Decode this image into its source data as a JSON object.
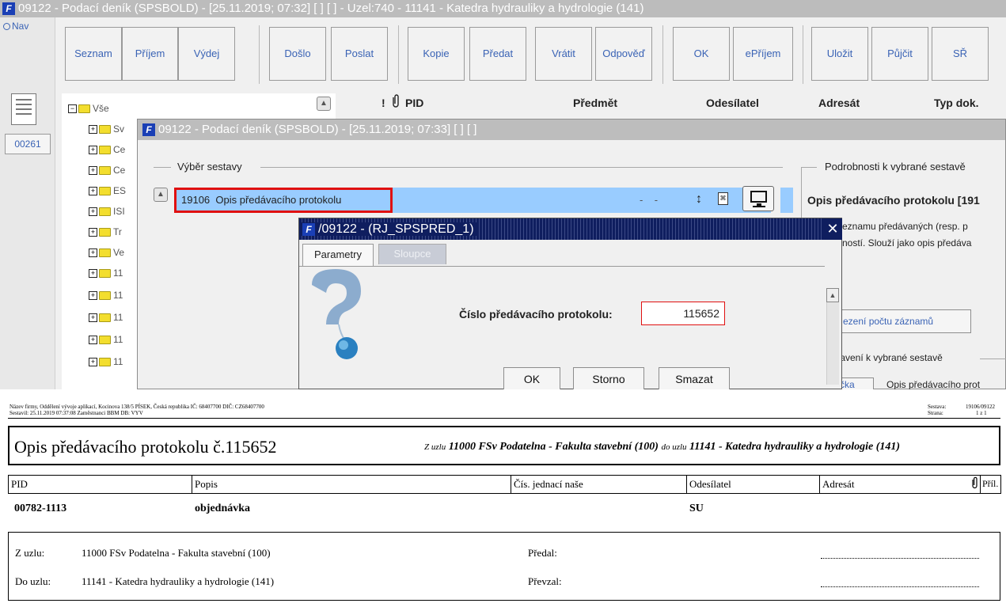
{
  "window": {
    "title": "09122 - Podací deník (SPSBOLD) - [25.11.2019; 07:32]  [ ]  [ ] - Uzel:740 - 11141 - Katedra hydrauliky a hydrologie (141)",
    "logo": "F"
  },
  "nav": {
    "label": "Nav",
    "badge": "00261"
  },
  "toolbar": {
    "buttons": [
      "Seznam",
      "Příjem",
      "Výdej",
      "Došlo",
      "Poslat",
      "Kopie",
      "Předat",
      "Vrátit",
      "Odpověď",
      "OK",
      "ePříjem",
      "Uložit",
      "Půjčit",
      "SŘ"
    ]
  },
  "tree": {
    "root": "Vše",
    "items": [
      "Sv",
      "Ce",
      "Ce",
      "ES",
      "ISI",
      "Tr",
      "Ve",
      "11",
      "11",
      "11",
      "11",
      "11"
    ]
  },
  "columns": {
    "mark": "!",
    "pid": "PID",
    "subject": "Předmět",
    "sender": "Odesílatel",
    "recipient": "Adresát",
    "type": "Typ dok."
  },
  "dialog1": {
    "title": "09122 - Podací deník (SPSBOLD) - [25.11.2019; 07:33]  [ ]  [ ]",
    "group_left": "Výběr sestavy",
    "group_right": "Podrobnosti k vybrané sestavě",
    "selected_report": {
      "code": "19106",
      "name": "Opis předávacího protokolu"
    },
    "dashes": "-    -",
    "detail_title": "Opis předávacího protokolu [191",
    "detail_text_1": "eznamu předávaných (resp. p",
    "detail_text_2": "ností. Slouží jako opis předáva",
    "limit_button": "ezení počtu záznamů",
    "settings_group": "stavení k vybrané sestavě",
    "bottom_left": "čka",
    "bottom_right": "Opis předávacího prot"
  },
  "dialog2": {
    "title": "/09122 - (RJ_SPSPRED_1)",
    "tabs": [
      "Parametry",
      "Sloupce"
    ],
    "field_label": "Číslo předávacího protokolu:",
    "field_value": "115652",
    "buttons": {
      "ok": "OK",
      "cancel": "Storno",
      "clear": "Smazat"
    }
  },
  "report": {
    "company_line": "Název firmy, Oddělení vývoje aplikací, Kocinova 138/5 PÍSEK, Česká republika  IČ: 68407700  DIČ: CZ68407700",
    "compiled_line": "Sestavil: 25.11.2019 07:37:08 Zaměstnanci BBM  DB: VYV",
    "sestava_label": "Sestava:",
    "sestava_value": "19106/09122",
    "strana_label": "Strana:",
    "strana_value": "1 z 1",
    "title": "Opis předávacího protokolu č.115652",
    "route_from_prefix": "Z uzlu",
    "route_from": "11000 FSv Podatelna - Fakulta stavební (100)",
    "route_to_prefix": "do uzlu",
    "route_to": "11141 - Katedra hydrauliky a hydrologie (141)",
    "headers": [
      "PID",
      "Popis",
      "Čís. jednací naše",
      "Odesílatel",
      "Adresát",
      "Příl."
    ],
    "row": {
      "pid": "00782-1113",
      "popis": "objednávka",
      "cj": "",
      "odesilatel": "SU",
      "adresat": ""
    },
    "footer": {
      "from_label": "Z uzlu:",
      "from_value": "11000 FSv Podatelna - Fakulta stavební (100)",
      "to_label": "Do uzlu:",
      "to_value": "11141 - Katedra hydrauliky a hydrologie (141)",
      "handed_label": "Předal:",
      "taken_label": "Převzal:"
    }
  }
}
